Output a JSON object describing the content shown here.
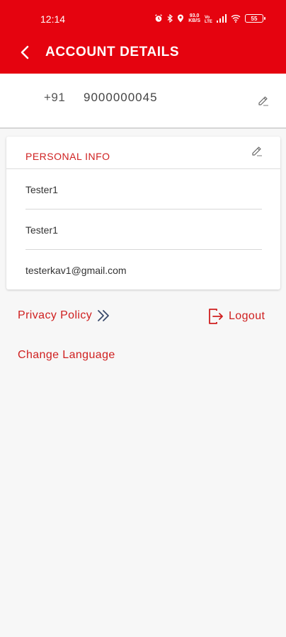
{
  "status_bar": {
    "time": "12:14",
    "icons": [
      "alarm-icon",
      "bluetooth-icon",
      "location-icon",
      "network-speed",
      "volte-icon",
      "signal-icon",
      "wifi-icon",
      "battery-icon"
    ],
    "net_speed_top": "93.0",
    "net_speed_bottom": "KB/S",
    "battery_level": "55"
  },
  "appbar": {
    "title": "ACCOUNT DETAILS",
    "back_icon": "chevron-left-icon"
  },
  "phone": {
    "country_code": "+91",
    "number": "9000000045",
    "edit_icon": "pencil-icon"
  },
  "personal_info": {
    "title": "PERSONAL INFO",
    "edit_icon": "pencil-icon",
    "fields": [
      "Tester1",
      "Tester1",
      "testerkav1@gmail.com"
    ]
  },
  "links": {
    "privacy_policy": "Privacy Policy",
    "privacy_icon": "double-chevron-right-icon",
    "logout": "Logout",
    "logout_icon": "logout-icon",
    "change_language": "Change Language"
  },
  "colors": {
    "primary": "#e5030f",
    "accent_text": "#cf1f1f",
    "background": "#f7f7f7",
    "privacy_chevron": "#3a4a6b"
  }
}
